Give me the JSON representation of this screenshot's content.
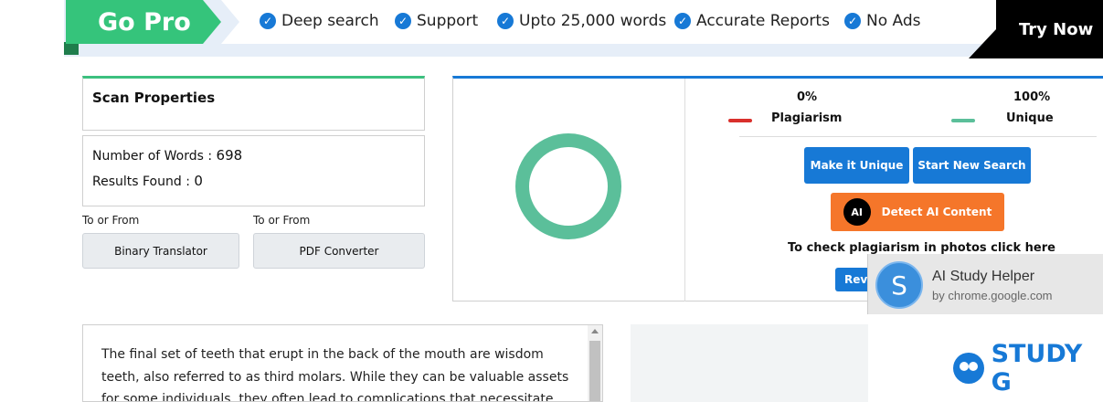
{
  "promo": {
    "go_pro": "Go Pro",
    "features": [
      "Deep search",
      "Support",
      "Upto 25,000 words",
      "Accurate Reports",
      "No Ads"
    ],
    "try_now": "Try Now"
  },
  "scan": {
    "title": "Scan Properties",
    "words_label": "Number of Words :",
    "words_value": "698",
    "results_label": "Results Found :",
    "results_value": "0"
  },
  "tools": [
    {
      "caption": "To or From",
      "label": "Binary Translator"
    },
    {
      "caption": "To or From",
      "label": "PDF Converter"
    }
  ],
  "result": {
    "plagiarism_pct": "0%",
    "unique_pct": "100%",
    "plagiarism_label": "Plagiarism",
    "unique_label": "Unique",
    "make_unique": "Make it Unique",
    "new_search": "Start New Search",
    "ai_icon": "AI",
    "detect_ai": "Detect AI Content",
    "photo_note": "To check plagiarism in photos click here",
    "rev_btn": "Rev",
    "colors": {
      "plagiarism": "#d9302c",
      "unique": "#5bbf9a"
    }
  },
  "text": {
    "content": "The final set of teeth that erupt in the back of the mouth are wisdom teeth, also referred to as third molars. While they can be valuable assets for some individuals, they often lead to complications that necessitate"
  },
  "toast": {
    "avatar_letter": "S",
    "title": "AI Study Helper",
    "subtitle": "by chrome.google.com"
  },
  "logo": {
    "text": "STUDY G"
  }
}
